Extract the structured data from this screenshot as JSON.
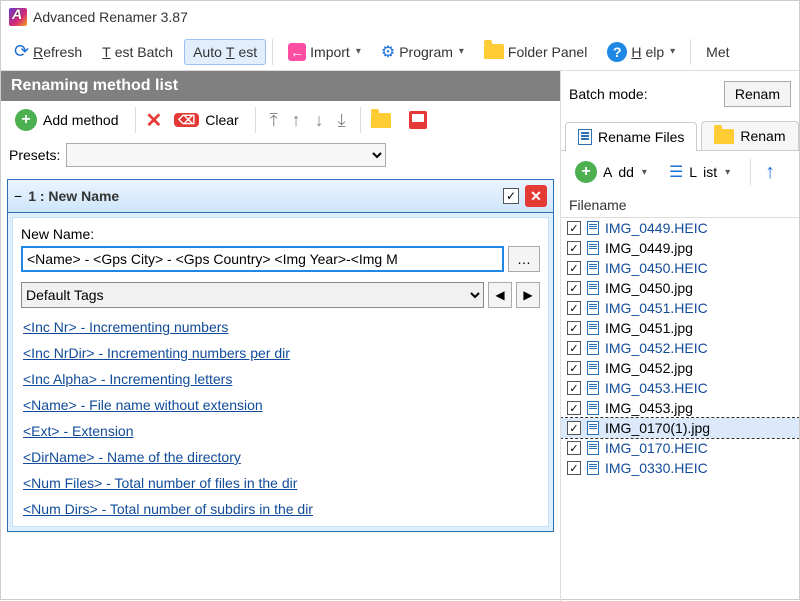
{
  "titlebar": {
    "title": "Advanced Renamer 3.87"
  },
  "toolbar": {
    "refresh": "Refresh",
    "test_batch": "Test Batch",
    "auto_test": "Auto Test",
    "import": "Import",
    "program": "Program",
    "folder_panel": "Folder Panel",
    "help": "Help",
    "met": "Met"
  },
  "section": {
    "title": "Renaming method list"
  },
  "method_tb": {
    "add_method": "Add method",
    "clear": "Clear"
  },
  "presets": {
    "label": "Presets:"
  },
  "method": {
    "header": "1 : New Name",
    "new_name_label": "New Name:",
    "new_name_value": "<Name> - <Gps City> - <Gps Country> <Img Year>-<Img M",
    "tags_dropdown": "Default Tags",
    "tags": [
      "<Inc Nr> - Incrementing numbers",
      "<Inc NrDir> - Incrementing numbers per dir",
      "<Inc Alpha> - Incrementing letters",
      "<Name> - File name without extension",
      "<Ext> - Extension",
      "<DirName> - Name of the directory",
      "<Num Files> - Total number of files in the dir",
      "<Num Dirs> - Total number of subdirs in the dir"
    ]
  },
  "right": {
    "batch_mode_label": "Batch mode:",
    "batch_mode_value": "Renam",
    "tab_rename": "Rename Files",
    "tab_folders": "Renam",
    "add": "Add",
    "list": "List",
    "col_filename": "Filename",
    "files": [
      {
        "name": "IMG_0449.HEIC",
        "blue": true,
        "sel": false
      },
      {
        "name": "IMG_0449.jpg",
        "blue": false,
        "sel": false
      },
      {
        "name": "IMG_0450.HEIC",
        "blue": true,
        "sel": false
      },
      {
        "name": "IMG_0450.jpg",
        "blue": false,
        "sel": false
      },
      {
        "name": "IMG_0451.HEIC",
        "blue": true,
        "sel": false
      },
      {
        "name": "IMG_0451.jpg",
        "blue": false,
        "sel": false
      },
      {
        "name": "IMG_0452.HEIC",
        "blue": true,
        "sel": false
      },
      {
        "name": "IMG_0452.jpg",
        "blue": false,
        "sel": false
      },
      {
        "name": "IMG_0453.HEIC",
        "blue": true,
        "sel": false
      },
      {
        "name": "IMG_0453.jpg",
        "blue": false,
        "sel": false
      },
      {
        "name": "IMG_0170(1).jpg",
        "blue": false,
        "sel": true
      },
      {
        "name": "IMG_0170.HEIC",
        "blue": true,
        "sel": false
      },
      {
        "name": "IMG_0330.HEIC",
        "blue": true,
        "sel": false
      }
    ]
  }
}
